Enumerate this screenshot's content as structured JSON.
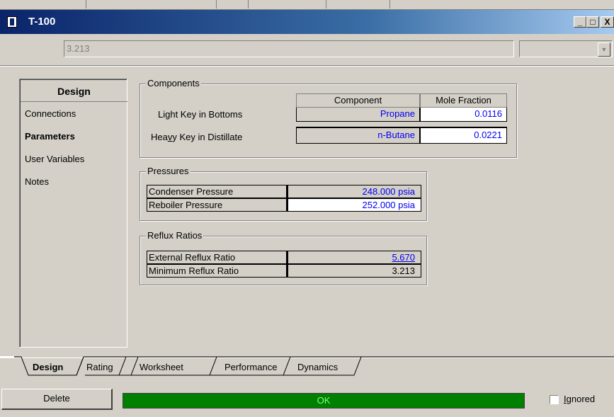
{
  "window": {
    "title": "T-100",
    "value_display": "3.213",
    "buttons": {
      "minimize": "_",
      "maximize": "□",
      "close": "X"
    }
  },
  "nav": {
    "header": "Design",
    "items": [
      {
        "label": "Connections",
        "selected": false
      },
      {
        "label": "Parameters",
        "selected": true
      },
      {
        "label": "User Variables",
        "selected": false
      },
      {
        "label": "Notes",
        "selected": false
      }
    ]
  },
  "components": {
    "group_label": "Components",
    "columns": [
      "Component",
      "Mole Fraction"
    ],
    "rows": [
      {
        "label": "Light Key in Bottoms",
        "component": "Propane",
        "mole_fraction": "0.0116"
      },
      {
        "label": "Heavy Key in Distillate",
        "component": "n-Butane",
        "mole_fraction": "0.0221"
      }
    ]
  },
  "pressures": {
    "group_label": "Pressures",
    "rows": [
      {
        "name": "Condenser Pressure",
        "value": "248.000 psia"
      },
      {
        "name": "Reboiler Pressure",
        "value": "252.000 psia"
      }
    ]
  },
  "reflux": {
    "group_label": "Reflux Ratios",
    "rows": [
      {
        "name": "External Reflux Ratio",
        "value": "5.670"
      },
      {
        "name": "Minimum Reflux Ratio",
        "value": "3.213"
      }
    ]
  },
  "tabs": [
    {
      "label": "Design",
      "active": true
    },
    {
      "label": "Rating",
      "active": false
    },
    {
      "label": "Worksheet",
      "active": false
    },
    {
      "label": "Performance",
      "active": false
    },
    {
      "label": "Dynamics",
      "active": false
    }
  ],
  "footer": {
    "delete_label": "Delete",
    "status": "OK",
    "ignored_label": "Ignored",
    "ignored_checked": false
  },
  "colors": {
    "blue_value": "#0000ee",
    "status_green": "#008000",
    "titlebar_dark": "#0a246a"
  }
}
